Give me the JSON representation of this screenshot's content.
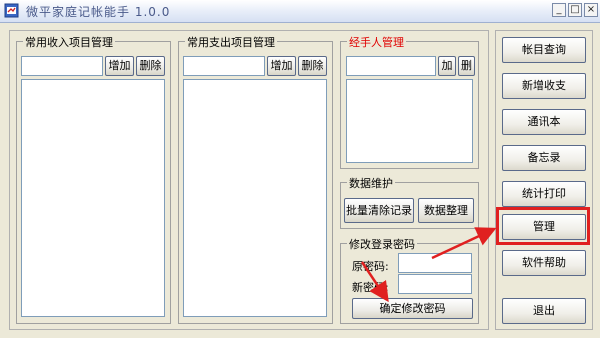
{
  "window": {
    "title": "微平家庭记帐能手 1.0.0",
    "controls": [
      "_",
      "□",
      "×"
    ]
  },
  "income": {
    "title": "常用收入项目管理",
    "add_label": "增加",
    "delete_label": "删除"
  },
  "expense": {
    "title": "常用支出项目管理",
    "add_label": "增加",
    "delete_label": "删除"
  },
  "handler": {
    "title": "经手人管理",
    "title_color": "#e00000",
    "add_label": "加",
    "delete_label": "删"
  },
  "maintenance": {
    "title": "数据维护",
    "clear_label": "批量清除记录",
    "organize_label": "数据整理"
  },
  "password": {
    "title": "修改登录密码",
    "old_label": "原密码:",
    "new_label": "新密码:",
    "confirm_label": "确定修改密码"
  },
  "side_buttons": {
    "ledger": "帐目查询",
    "new_entry": "新增收支",
    "contacts": "通讯本",
    "memo": "备忘录",
    "stats": "统计打印",
    "manage": "管理",
    "help": "软件帮助",
    "exit": "退出"
  },
  "annotation": {
    "color": "#e02020"
  }
}
